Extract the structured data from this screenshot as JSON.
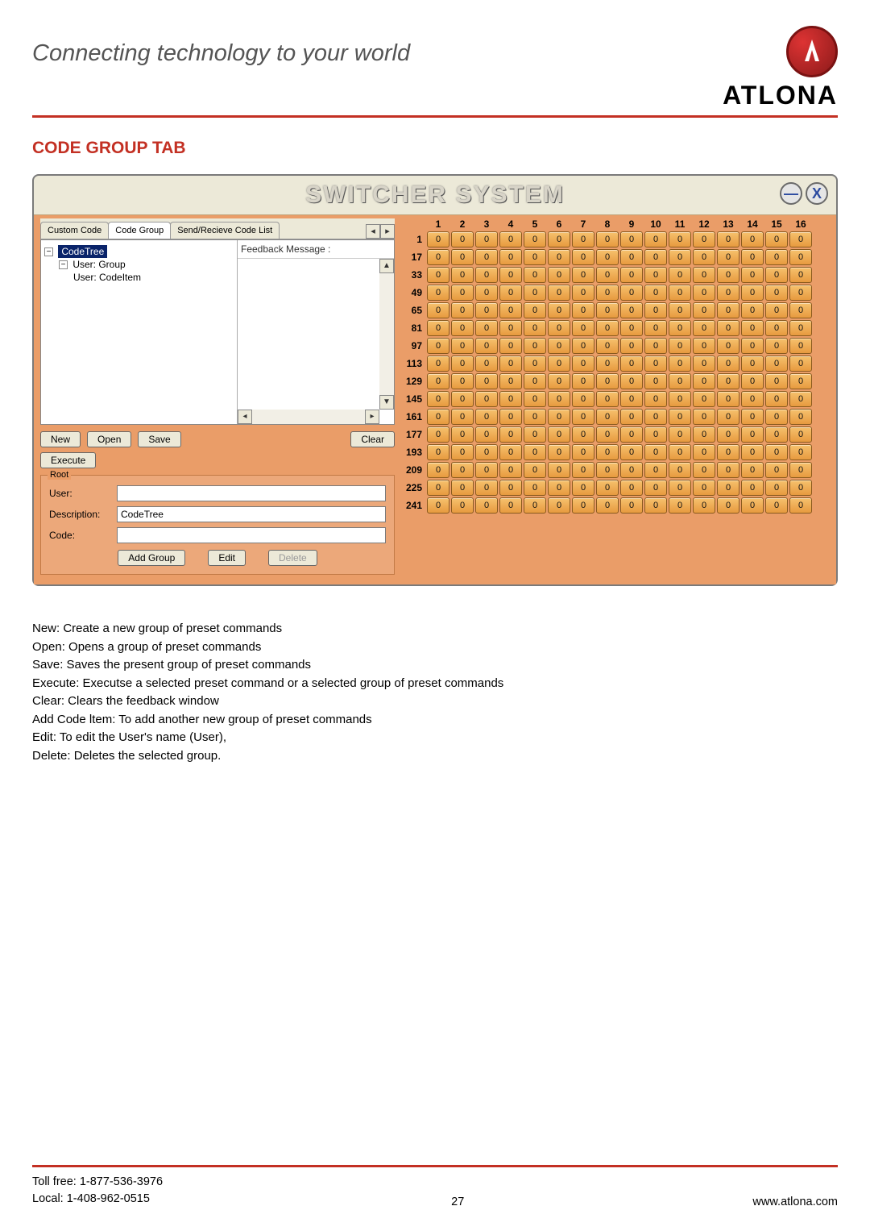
{
  "tagline": "Connecting technology to your world",
  "brand": "ATLONA",
  "section_title": "CODE GROUP TAB",
  "app": {
    "title": "SWITCHER SYSTEM",
    "minimize": "—",
    "close": "X",
    "tabs": [
      "Custom Code",
      "Code Group",
      "Send/Recieve Code List"
    ],
    "tab_scroll_left": "◂",
    "tab_scroll_right": "▸",
    "tree": {
      "root": "CodeTree",
      "group": "User: Group",
      "item": "User: CodeItem"
    },
    "feedback_label": "Feedback Message :",
    "buttons": {
      "new": "New",
      "open": "Open",
      "save": "Save",
      "clear": "Clear",
      "execute": "Execute",
      "add_group": "Add Group",
      "edit": "Edit",
      "delete": "Delete"
    },
    "root_group": {
      "legend": "Root",
      "user_label": "User:",
      "user_value": "",
      "description_label": "Description:",
      "description_value": "CodeTree",
      "code_label": "Code:",
      "code_value": ""
    },
    "grid": {
      "columns": [
        "1",
        "2",
        "3",
        "4",
        "5",
        "6",
        "7",
        "8",
        "9",
        "10",
        "11",
        "12",
        "13",
        "14",
        "15",
        "16"
      ],
      "row_starts": [
        "1",
        "17",
        "33",
        "49",
        "65",
        "81",
        "97",
        "113",
        "129",
        "145",
        "161",
        "177",
        "193",
        "209",
        "225",
        "241"
      ],
      "cell_value": "0"
    }
  },
  "body_lines": [
    "New: Create a new group of preset commands",
    "Open: Opens a group of preset commands",
    "Save: Saves the present group of preset commands",
    "Execute: Executse a selected preset command or a selected group of preset commands",
    "Clear: Clears the feedback window",
    "Add Code ltem: To add another new group of preset commands",
    "Edit: To edit the User's name (User),",
    "Delete: Deletes the selected group."
  ],
  "footer": {
    "toll_free_label": "Toll free:",
    "toll_free": "1-877-536-3976",
    "local_label": "Local:",
    "local": "1-408-962-0515",
    "page": "27",
    "site": "www.atlona.com"
  }
}
